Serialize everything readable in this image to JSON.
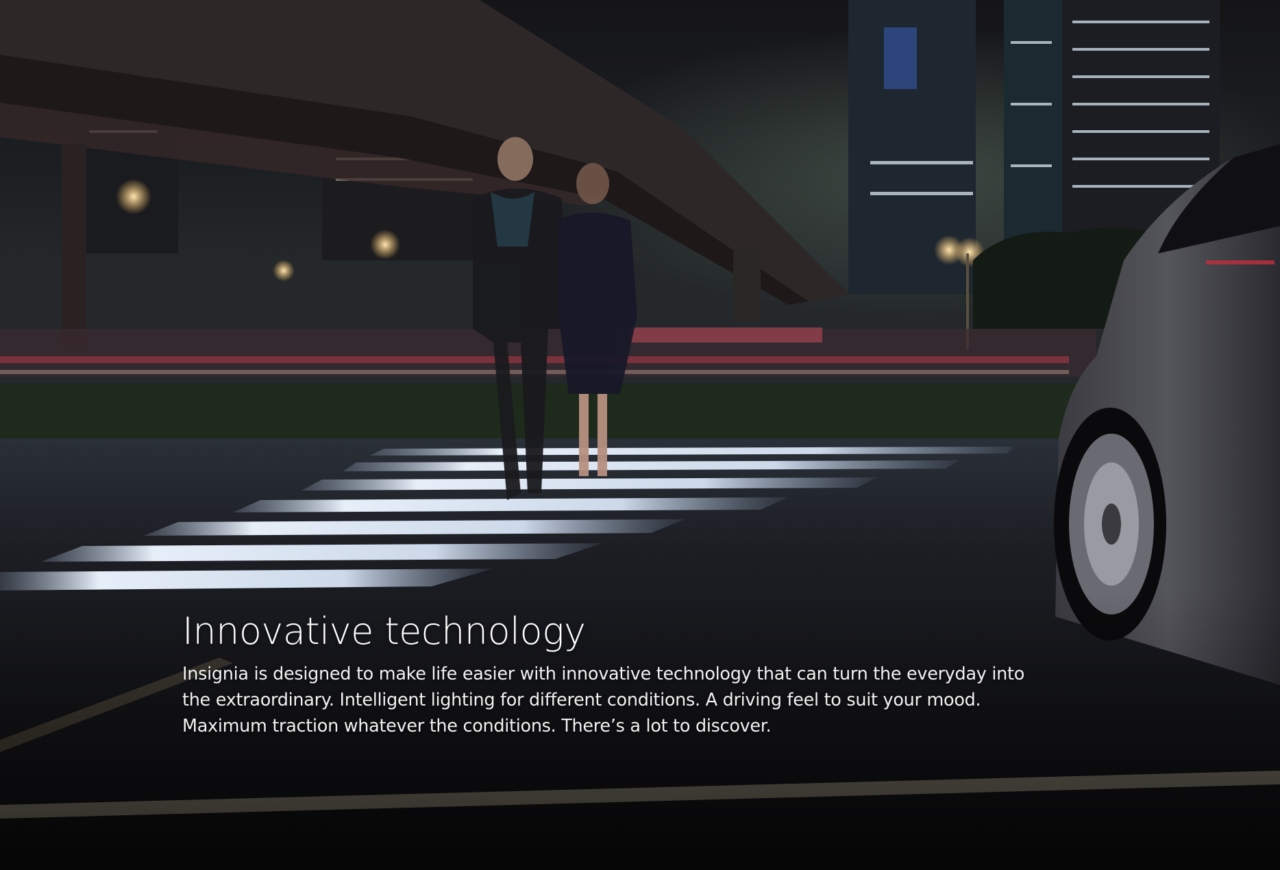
{
  "page": {
    "headline": "Innovative technology",
    "body": "Insignia is designed to make life easier with innovative technology that can turn the everyday into the extraordinary. Intelligent lighting for different conditions. A driving feel to suit your mood. Maximum traction whatever the conditions. There’s a lot to discover."
  },
  "colors": {
    "background": "#0d0c0e",
    "text": "#ffffff"
  }
}
